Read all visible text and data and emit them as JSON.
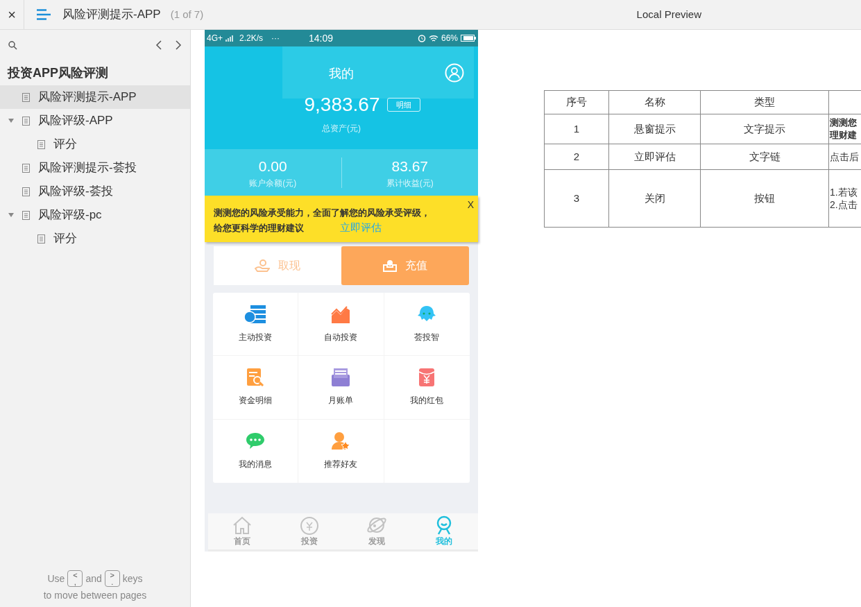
{
  "top_bar": {
    "close": "×",
    "title": "风险评测提示-APP",
    "page_count": "(1 of 7)",
    "preview_label": "Local Preview"
  },
  "sidebar": {
    "project_title": "投资APP风险评测",
    "items": [
      {
        "label": "风险评测提示-APP",
        "selected": true
      },
      {
        "label": "风险评级-APP",
        "selected": false,
        "expanded": true,
        "children": [
          {
            "label": "评分",
            "selected": false
          }
        ]
      },
      {
        "label": "风险评测提示-荟投",
        "selected": false
      },
      {
        "label": "风险评级-荟投",
        "selected": false
      },
      {
        "label": "风险评级-pc",
        "selected": false,
        "expanded": true,
        "children": [
          {
            "label": "评分",
            "selected": false
          }
        ]
      }
    ],
    "footer": {
      "use": "Use",
      "key_prev": [
        "<",
        ","
      ],
      "and": "and",
      "key_next": [
        ">",
        "."
      ],
      "keys": "keys",
      "line2": "to move between pages"
    }
  },
  "phone": {
    "status_bar": {
      "network": "4G+",
      "speed": "2.2K/s",
      "more": "···",
      "time": "14:09",
      "battery": "66%"
    },
    "header": {
      "title": "我的",
      "total": "9,383.67",
      "detail_button": "明细",
      "total_label": "总资产(元)"
    },
    "stats": [
      {
        "value": "0.00",
        "label": "账户余额(元)"
      },
      {
        "value": "83.67",
        "label": "累计收益(元)"
      }
    ],
    "banner": {
      "lines": [
        "测测您的风险承受能力，全面了解您的风险承受评级，",
        "给您更科学的理财建议"
      ],
      "link": "立即评估",
      "close": "X"
    },
    "actions": [
      {
        "label": "取现",
        "kind": "withdraw"
      },
      {
        "label": "充值",
        "kind": "recharge"
      }
    ],
    "grid": [
      {
        "label": "主动投资",
        "kind": "coins"
      },
      {
        "label": "自动投资",
        "kind": "chart"
      },
      {
        "label": "荟投智",
        "kind": "octopus"
      },
      {
        "label": "资金明细",
        "kind": "doc"
      },
      {
        "label": "月账单",
        "kind": "bill"
      },
      {
        "label": "我的红包",
        "kind": "packet"
      },
      {
        "label": "我的消息",
        "kind": "chat"
      },
      {
        "label": "推荐好友",
        "kind": "friend"
      }
    ],
    "tabs": [
      {
        "label": "首页",
        "kind": "home",
        "selected": false
      },
      {
        "label": "投资",
        "kind": "invest",
        "selected": false
      },
      {
        "label": "发现",
        "kind": "planet",
        "selected": false
      },
      {
        "label": "我的",
        "kind": "me",
        "selected": true
      }
    ]
  },
  "table": {
    "columns": [
      "序号",
      "名称",
      "类型"
    ],
    "rows": [
      {
        "cells": [
          "1",
          "悬窗提示",
          "文字提示"
        ],
        "description": [
          "测测您",
          "理财建"
        ],
        "emphasis": true
      },
      {
        "cells": [
          "2",
          "立即评估",
          "文字链"
        ],
        "description": [
          "点击后"
        ],
        "emphasis": false
      },
      {
        "cells": [
          "3",
          "关闭",
          "按钮"
        ],
        "description": [
          "1.若该",
          "2.点击"
        ],
        "emphasis": false
      }
    ]
  }
}
